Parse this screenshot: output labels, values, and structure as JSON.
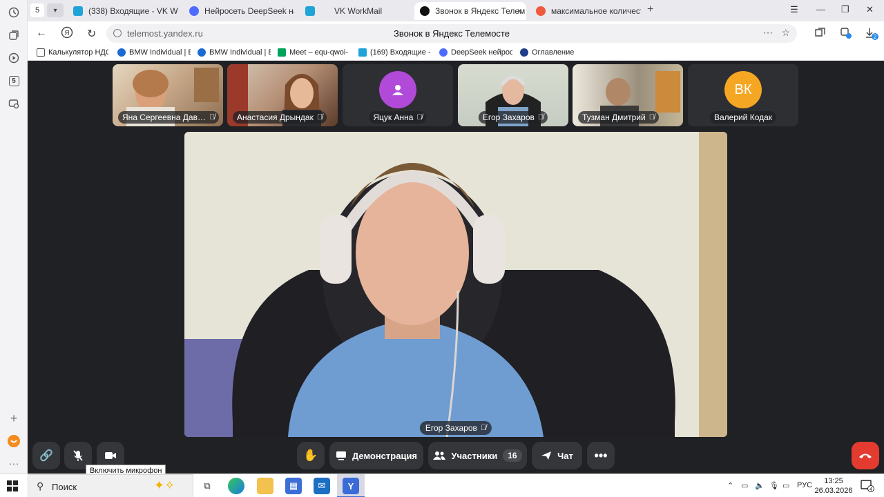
{
  "rail": {
    "badge": "5"
  },
  "tabs": {
    "counter": "5",
    "items": [
      {
        "label": "(338) Входящие - VK Wor",
        "fav_color": "#20a4d8"
      },
      {
        "label": "Нейросеть DeepSeek на р",
        "fav_color": "#4d6bfe"
      },
      {
        "label": "VK WorkMail",
        "fav_color": "#20a4d8"
      },
      {
        "label": "Звонок в Яндекс Телем",
        "fav_color": "#111111"
      },
      {
        "label": "максимальное количест",
        "fav_color": "#f05a3c"
      }
    ],
    "close_glyph": "×",
    "new_tab_glyph": "+"
  },
  "address": {
    "url": "telemost.yandex.ru",
    "page_title": "Звонок в Яндекс Телемосте",
    "downloads_badge": "2"
  },
  "bookmarks": [
    {
      "label": "Калькулятор НДС",
      "color": "#555555"
    },
    {
      "label": "BMW Individual | E",
      "color": "#1c69d4"
    },
    {
      "label": "BMW Individual | E",
      "color": "#1c69d4"
    },
    {
      "label": "Meet – equ-qwoi-",
      "color": "#00a35c"
    },
    {
      "label": "(169) Входящие -",
      "color": "#20a4d8"
    },
    {
      "label": "DeepSeek нейросе",
      "color": "#4d6bfe"
    },
    {
      "label": "Оглавление",
      "color": "#1f3e8a"
    }
  ],
  "participants": [
    {
      "name": "Яна Сергеевна Дав…",
      "type": "video",
      "bg": "#c9b59a"
    },
    {
      "name": "Анастасия Дрындак",
      "type": "video",
      "bg": "#a8806a"
    },
    {
      "name": "Яцук Анна",
      "type": "avatar",
      "initials": "",
      "avatar_color": "#b24ad9"
    },
    {
      "name": "Егор Захаров",
      "type": "video",
      "bg": "#bfc6b8"
    },
    {
      "name": "Тузман Дмитрий",
      "type": "video",
      "bg": "#8f8a7a"
    },
    {
      "name": "Валерий Кодак",
      "type": "avatar",
      "initials": "ВК",
      "avatar_color": "#f5a623"
    }
  ],
  "main_speaker": {
    "name": "Егор Захаров"
  },
  "controls": {
    "demo_label": "Демонстрация",
    "participants_label": "Участники",
    "participants_count": "16",
    "chat_label": "Чат",
    "mic_tooltip": "Включить микрофон"
  },
  "taskbar": {
    "search_placeholder": "Поиск",
    "lang": "РУС",
    "time": "13:25",
    "date": "26.03.2026",
    "notif_count": "4"
  }
}
